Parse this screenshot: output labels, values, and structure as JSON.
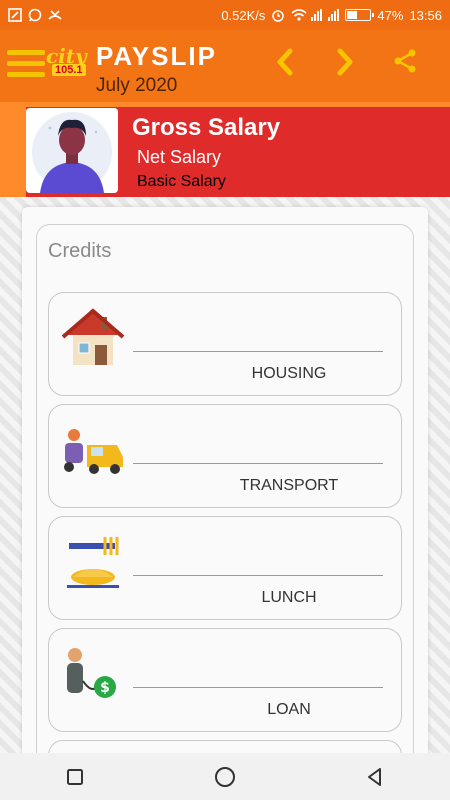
{
  "status_bar": {
    "speed": "0.52K/s",
    "battery": "47%",
    "battery_level": 0.47,
    "time": "13:56",
    "icons": [
      "screenshot-icon",
      "whatsapp-icon",
      "missed-call-icon",
      "alarm-icon",
      "wifi-icon",
      "signal-icon",
      "signal-icon"
    ]
  },
  "app_bar": {
    "title": "PAYSLIP",
    "subtitle": "July 2020",
    "logo_word": "city",
    "logo_freq": "105.1",
    "prev_icon": "‹",
    "next_icon": "›",
    "share_icon": "share-icon",
    "accent_color": "#f37415"
  },
  "salary": {
    "gross": "Gross Salary",
    "net": "Net Salary",
    "basic": "Basic Salary",
    "header_color": "#e02b2b"
  },
  "credits": {
    "heading": "Credits",
    "items": [
      {
        "label": "HOUSING",
        "icon": "house-icon"
      },
      {
        "label": "TRANSPORT",
        "icon": "transport-icon"
      },
      {
        "label": "LUNCH",
        "icon": "lunch-icon"
      },
      {
        "label": "LOAN",
        "icon": "loan-icon"
      }
    ]
  },
  "bottom_nav": {
    "recent": "□",
    "home": "○",
    "back": "◁"
  }
}
